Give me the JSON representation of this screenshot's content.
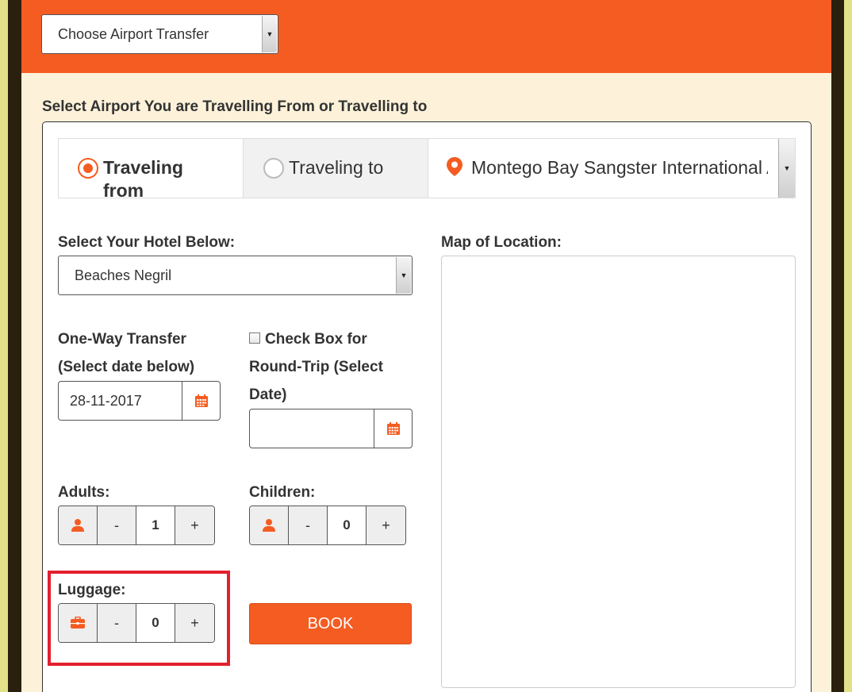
{
  "top_select": {
    "value": "Choose Airport Transfer"
  },
  "section_heading": "Select Airport You are Travelling From or Travelling to",
  "direction_tabs": {
    "from_label": "Traveling from",
    "to_label": "Traveling to",
    "selected": "from"
  },
  "airport_select": {
    "value": "Montego Bay Sangster International Airport"
  },
  "hotel": {
    "label": "Select Your Hotel Below:",
    "value": "Beaches Negril"
  },
  "map": {
    "label": "Map of Location:"
  },
  "one_way": {
    "label_line1": "One-Way Transfer",
    "label_line2": "(Select date below)",
    "date_value": "28-11-2017"
  },
  "round_trip": {
    "label_line1": "Check Box for",
    "label_line2": "Round-Trip (Select",
    "label_line3": "Date)",
    "checked": false,
    "date_value": ""
  },
  "adults": {
    "label": "Adults:",
    "value": "1"
  },
  "children": {
    "label": "Children:",
    "value": "0"
  },
  "luggage": {
    "label": "Luggage:",
    "value": "0"
  },
  "stepper": {
    "minus": "-",
    "plus": "+"
  },
  "book_button": {
    "label": "BOOK"
  },
  "colors": {
    "accent": "#f45c22",
    "panel_bg": "#fdf2d9",
    "frame": "#2b1f0e",
    "highlight": "#e3202e"
  },
  "icons": {
    "location": "map-pin-icon",
    "calendar": "calendar-icon",
    "person": "person-icon",
    "luggage": "briefcase-icon",
    "dropdown": "caret-down-icon"
  }
}
